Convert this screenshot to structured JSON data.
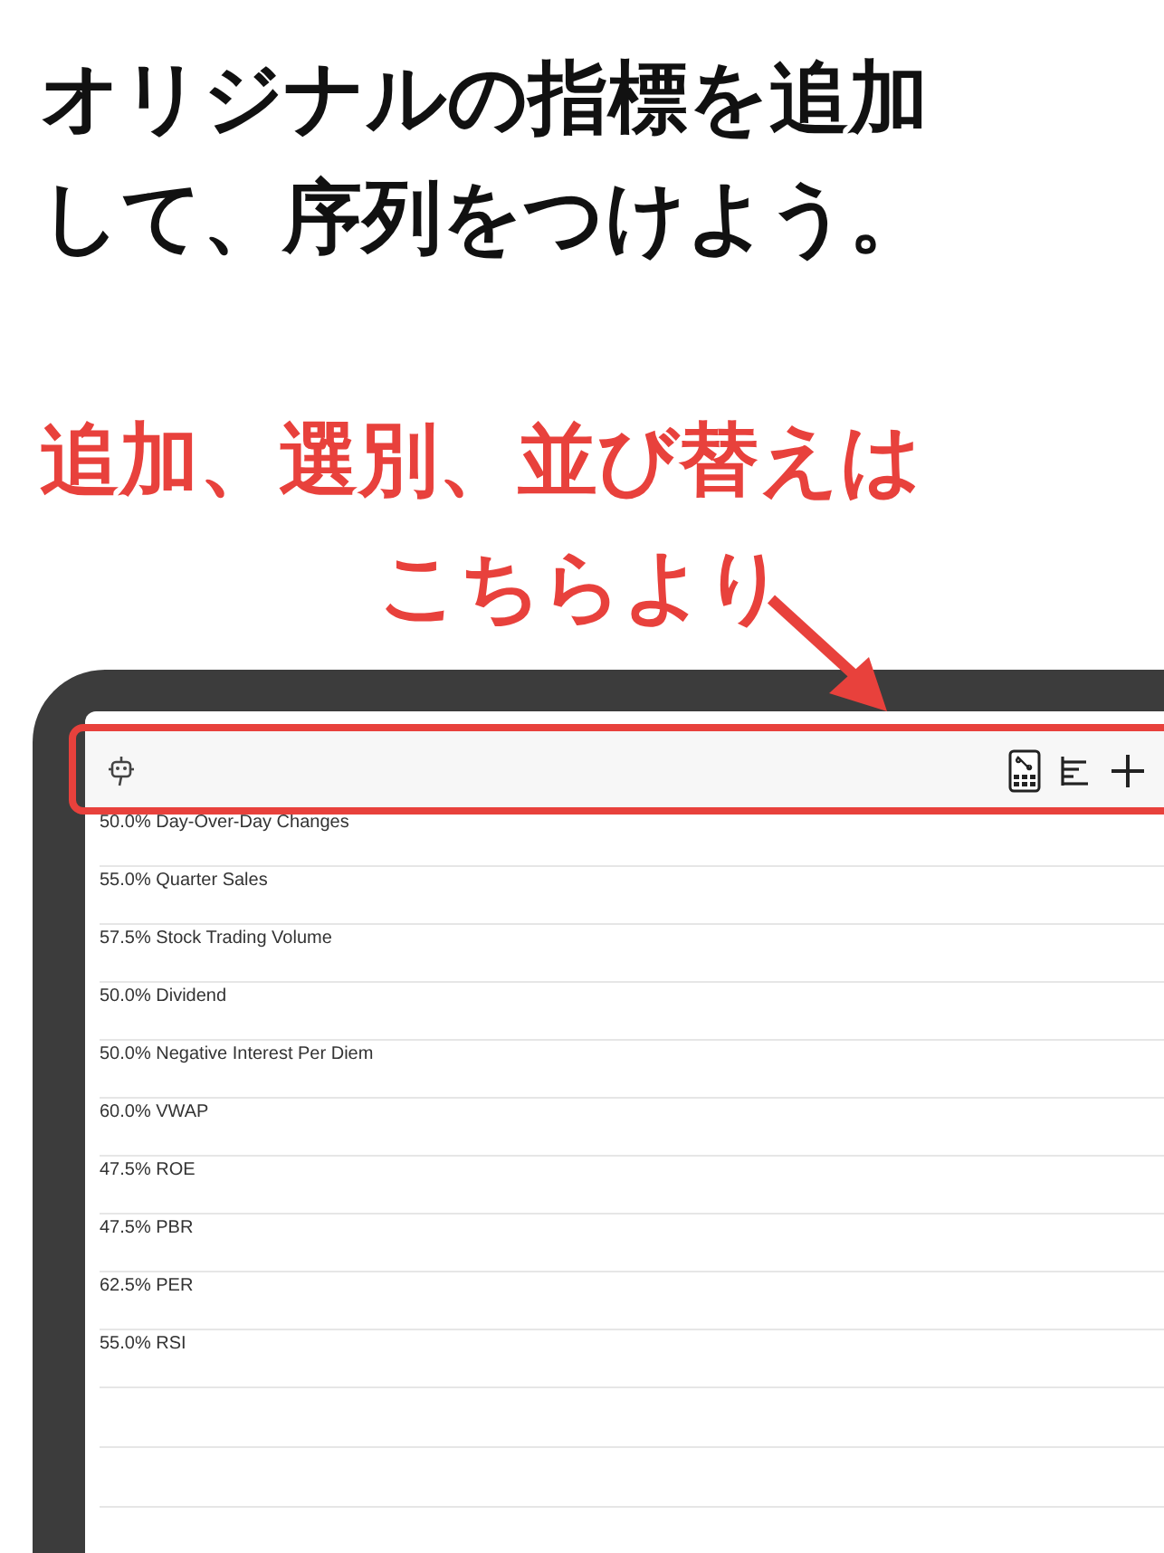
{
  "headline": [
    "オリジナルの指標を追加",
    "して、序列をつけよう。"
  ],
  "callout": [
    "追加、選別、並び替えは",
    "こちらより"
  ],
  "indicators": [
    {
      "label": "50.0% Day-Over-Day Changes"
    },
    {
      "label": "55.0% Quarter Sales"
    },
    {
      "label": "57.5% Stock Trading Volume"
    },
    {
      "label": "50.0% Dividend"
    },
    {
      "label": "50.0% Negative Interest Per Diem"
    },
    {
      "label": "60.0% VWAP"
    },
    {
      "label": "47.5% ROE"
    },
    {
      "label": "47.5% PBR"
    },
    {
      "label": "62.5% PER"
    },
    {
      "label": "55.0% RSI"
    }
  ]
}
